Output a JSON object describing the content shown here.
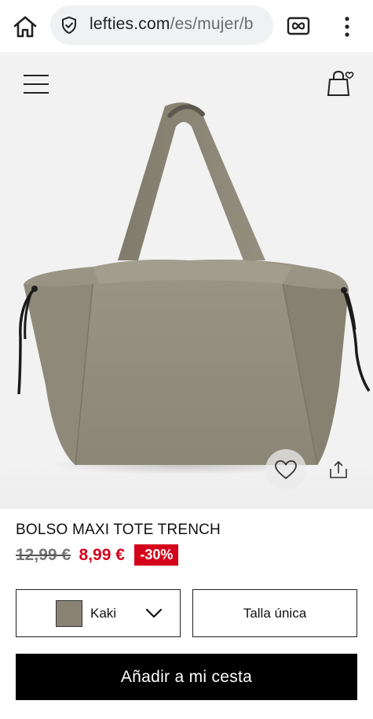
{
  "browser": {
    "url_domain": "lefties.com",
    "url_path": "/es/mujer/b",
    "icons": {
      "home": "home-icon",
      "security": "shield-check-icon",
      "tabs": "tab-switcher-icon",
      "menu": "more-vert-icon"
    }
  },
  "header": {
    "icons": {
      "menu": "hamburger-icon",
      "cart": "shopping-bag-heart-icon"
    }
  },
  "gallery": {
    "icons": {
      "favorite": "heart-icon",
      "share": "share-icon"
    }
  },
  "product": {
    "name": "BOLSO MAXI TOTE TRENCH",
    "old_price": "12,99 €",
    "new_price": "8,99 €",
    "discount": "-30%"
  },
  "options": {
    "color": {
      "selected": "Kaki",
      "swatch_color": "#8a8374"
    },
    "size": {
      "selected": "Talla única"
    }
  },
  "cta": {
    "add_to_cart": "Añadir a mi cesta"
  },
  "colors": {
    "accent_red": "#d4021b",
    "button_black": "#000000"
  }
}
